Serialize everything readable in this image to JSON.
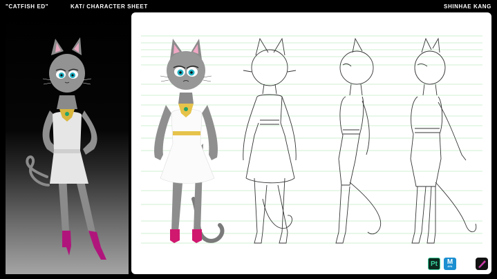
{
  "header": {
    "project_title": "\"CATFISH ED\"",
    "sheet_title": "KAT/ CHARACTER SHEET",
    "artist_name": "SHINHAE KANG"
  },
  "software_icons": [
    {
      "name": "substance-painter",
      "label": "Pt"
    },
    {
      "name": "maya",
      "label": "M",
      "sublabel": "AYA"
    },
    {
      "name": "zbrush",
      "label": ""
    },
    {
      "name": "procreate",
      "label": ""
    }
  ],
  "colors": {
    "accent_pink": "#d0186f",
    "eye_teal": "#1fb0c4",
    "guide_green": "#9fe0a6",
    "necklace_gold": "#e6c34a",
    "fur_gray": "#8e8e8e"
  }
}
